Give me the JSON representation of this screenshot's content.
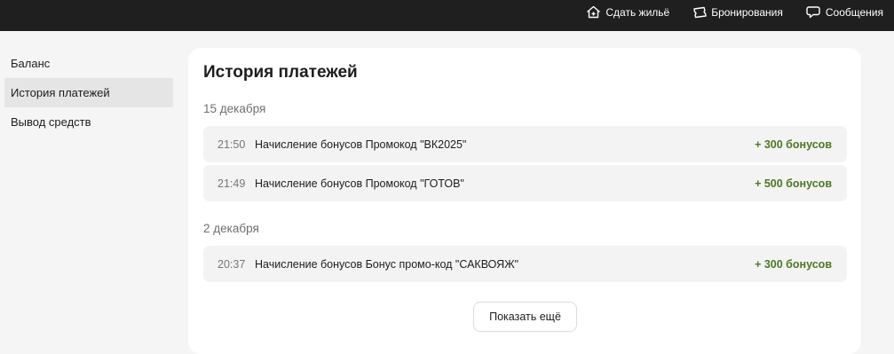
{
  "header": {
    "nav": [
      {
        "label": "Сдать жильё",
        "icon": "house-plus-icon"
      },
      {
        "label": "Бронирования",
        "icon": "ticket-icon"
      },
      {
        "label": "Сообщения",
        "icon": "chat-bubble-icon"
      }
    ]
  },
  "sidebar": {
    "items": [
      {
        "label": "Баланс",
        "active": false
      },
      {
        "label": "История платежей",
        "active": true
      },
      {
        "label": "Вывод средств",
        "active": false
      }
    ]
  },
  "main": {
    "title": "История платежей",
    "groups": [
      {
        "date": "15 декабря",
        "entries": [
          {
            "time": "21:50",
            "description": "Начисление бонусов Промокод \"ВК2025\"",
            "amount": "+ 300 бонусов"
          },
          {
            "time": "21:49",
            "description": "Начисление бонусов Промокод \"ГОТОВ\"",
            "amount": "+ 500 бонусов"
          }
        ]
      },
      {
        "date": "2 декабря",
        "entries": [
          {
            "time": "20:37",
            "description": "Начисление бонусов Бонус промо-код \"САКВОЯЖ\"",
            "amount": "+ 300 бонусов"
          }
        ]
      }
    ],
    "show_more_label": "Показать ещё"
  },
  "colors": {
    "topbar": "#1f1f1f",
    "page_background": "#f5f5f5",
    "bonus_amount": "#4c7a25",
    "row_background": "#f3f3f3",
    "sidebar_active": "#e5e5e5"
  }
}
